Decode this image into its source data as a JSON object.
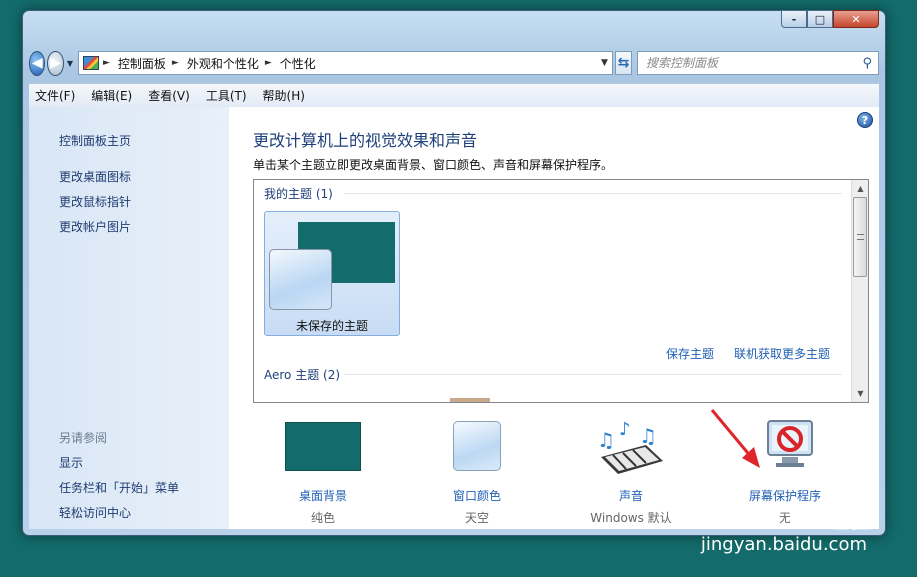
{
  "window": {
    "caption_buttons": [
      "-",
      "□",
      "✕"
    ]
  },
  "navbar": {
    "breadcrumb": [
      "控制面板",
      "外观和个性化",
      "个性化"
    ],
    "search_placeholder": "搜索控制面板"
  },
  "menu": [
    "文件(F)",
    "编辑(E)",
    "查看(V)",
    "工具(T)",
    "帮助(H)"
  ],
  "sidebar": {
    "links": [
      "控制面板主页",
      "更改桌面图标",
      "更改鼠标指针",
      "更改帐户图片"
    ],
    "see_also_heading": "另请参阅",
    "see_also": [
      "显示",
      "任务栏和「开始」菜单",
      "轻松访问中心"
    ]
  },
  "main": {
    "title": "更改计算机上的视觉效果和声音",
    "subtitle": "单击某个主题立即更改桌面背景、窗口颜色、声音和屏幕保护程序。",
    "my_themes_heading": "我的主题 (1)",
    "unsaved_theme_label": "未保存的主题",
    "save_theme_link": "保存主题",
    "get_more_link": "联机获取更多主题",
    "aero_heading": "Aero 主题 (2)"
  },
  "bottom": [
    {
      "label": "桌面背景",
      "sub": "纯色"
    },
    {
      "label": "窗口颜色",
      "sub": "天空"
    },
    {
      "label": "声音",
      "sub": "Windows 默认"
    },
    {
      "label": "屏幕保护程序",
      "sub": "无"
    }
  ],
  "watermark": {
    "text": "Bai经验",
    "url": "jingyan.baidu.com"
  },
  "colors": {
    "desktop": "#136b6b",
    "link": "#1f5fb5",
    "title": "#1e3f7a",
    "arrow": "#e0262b"
  }
}
